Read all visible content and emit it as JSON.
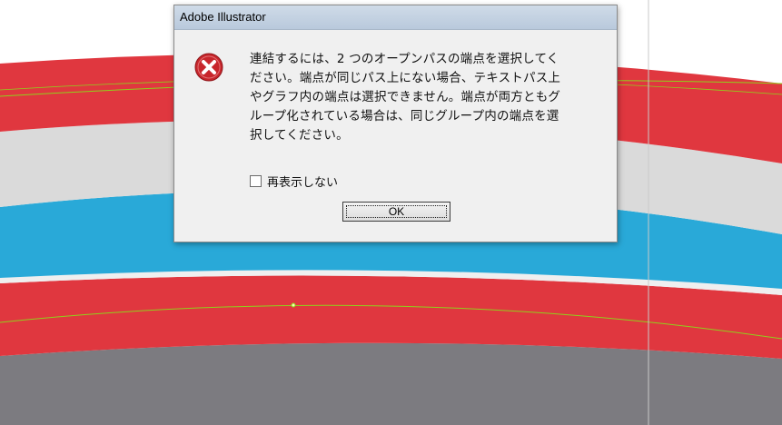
{
  "dialog": {
    "title": "Adobe Illustrator",
    "icon": "error-icon",
    "message": "連結するには、2 つのオープンパスの端点を選択してく\nださい。端点が同じパス上にない場合、テキストパス上\nやグラフ内の端点は選択できません。端点が両方ともグ\nループ化されている場合は、同じグループ内の端点を選\n択してください。",
    "dont_show_again_label": "再表示しない",
    "dont_show_again_checked": false,
    "ok_label": "OK"
  },
  "colors": {
    "red_band": "#e0373f",
    "blue_band": "#29a9d8",
    "light_gray_band": "#dcdcdc",
    "dark_gray_band": "#7c7b80",
    "guide_line": "#8fd11c",
    "error_icon": "#c8262c"
  }
}
